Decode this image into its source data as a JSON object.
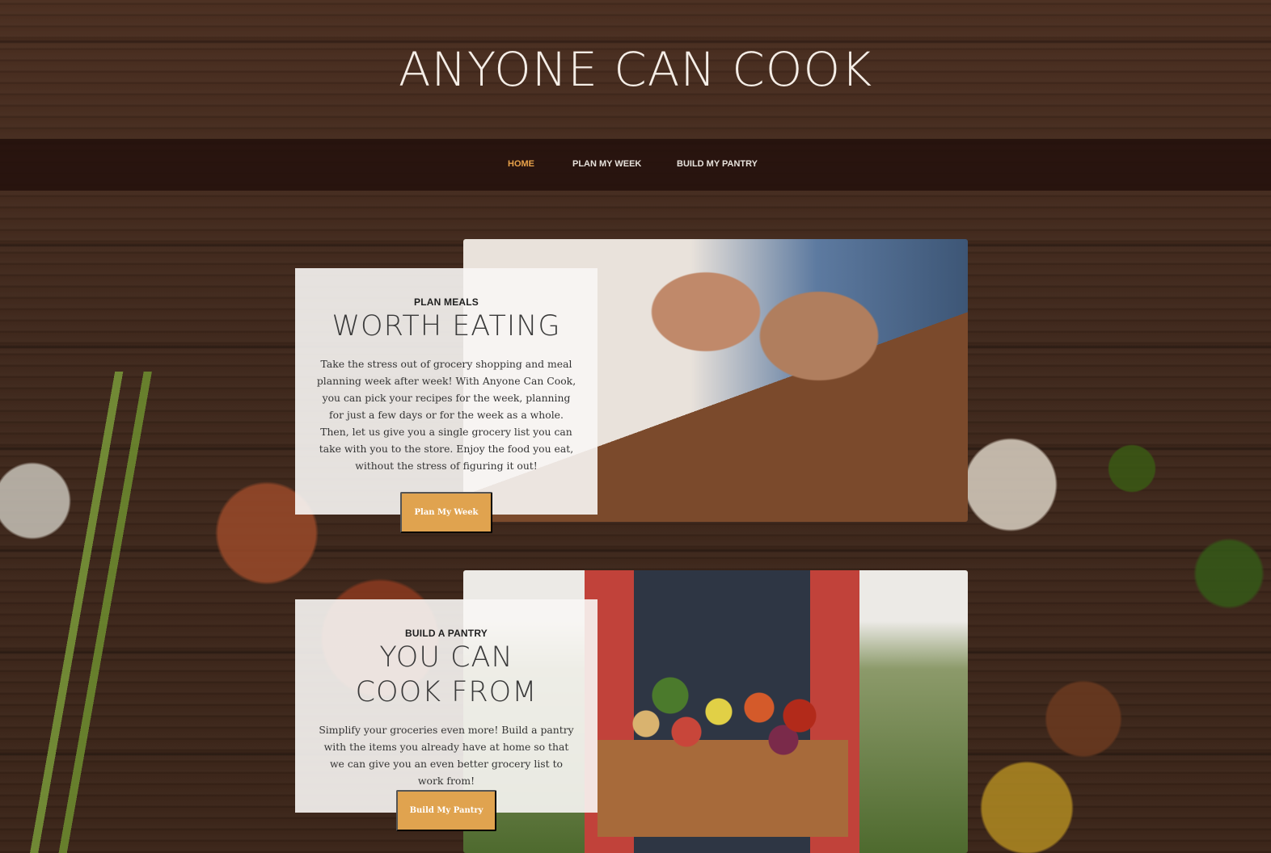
{
  "site": {
    "title": "ANYONE CAN COOK"
  },
  "nav": {
    "items": [
      {
        "label": "HOME",
        "active": true
      },
      {
        "label": "PLAN MY WEEK",
        "active": false
      },
      {
        "label": "BUILD MY PANTRY",
        "active": false
      }
    ]
  },
  "features": [
    {
      "eyebrow": "PLAN MEALS",
      "headline": "WORTH EATING",
      "body": "Take the stress out of grocery shopping and meal planning week after week! With Anyone Can Cook, you can pick your recipes for the week, planning for just a few days or for the week as a whole. Then, let us give you a single grocery list you can take with you to the store. Enjoy the food you eat, without the stress of figuring it out!",
      "button_label": "Plan My Week"
    },
    {
      "eyebrow": "BUILD A PANTRY",
      "headline": "YOU CAN COOK FROM",
      "body": "Simplify your groceries even more! Build a pantry with the items you already have at home so that we can give you an even better grocery list to work from!",
      "button_label": "Build My Pantry"
    }
  ],
  "colors": {
    "accent": "#e0a34f",
    "nav_active": "#e7a14a",
    "nav_background": "#24110c"
  }
}
